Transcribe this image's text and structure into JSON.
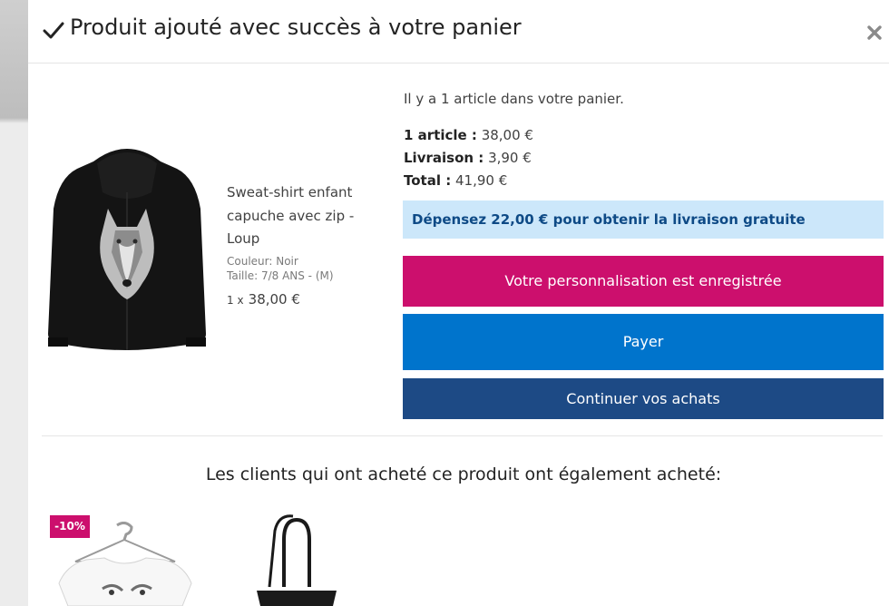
{
  "modal": {
    "title": "Produit ajouté avec succès à votre panier",
    "check_icon": "check-icon",
    "close_icon": "close-icon"
  },
  "product": {
    "image_icon": "black-hoodie-wolf-image",
    "name": "Sweat-shirt enfant capuche avec zip - Loup",
    "color": "Couleur: Noir",
    "size": "Taille: 7/8 ANS - (M)",
    "qty": "1 x",
    "price": "38,00 €"
  },
  "cart": {
    "count_text": "Il y a 1 article dans votre panier.",
    "articles_label": "1 article :",
    "articles_value": "38,00 €",
    "shipping_label": "Livraison :",
    "shipping_value": "3,90 €",
    "total_label": "Total :",
    "total_value": "41,90 €",
    "free_shipping_text": "Dépensez 22,00 € pour obtenir la livraison gratuite"
  },
  "actions": {
    "personalization_label": "Votre personnalisation est enregistrée",
    "pay_label": "Payer",
    "continue_label": "Continuer vos achats"
  },
  "also_bought": {
    "heading": "Les clients qui ont acheté ce produit ont également acheté:",
    "items": [
      {
        "badge": "-10%",
        "icon": "white-tshirt-wolf-image"
      },
      {
        "icon": "black-tote-bag-image"
      }
    ]
  },
  "colors": {
    "pink": "#cc0f6d",
    "blue": "#0074cc",
    "navy": "#1d4a85",
    "info_bg": "#cce7fa",
    "info_text": "#0e4a86"
  }
}
